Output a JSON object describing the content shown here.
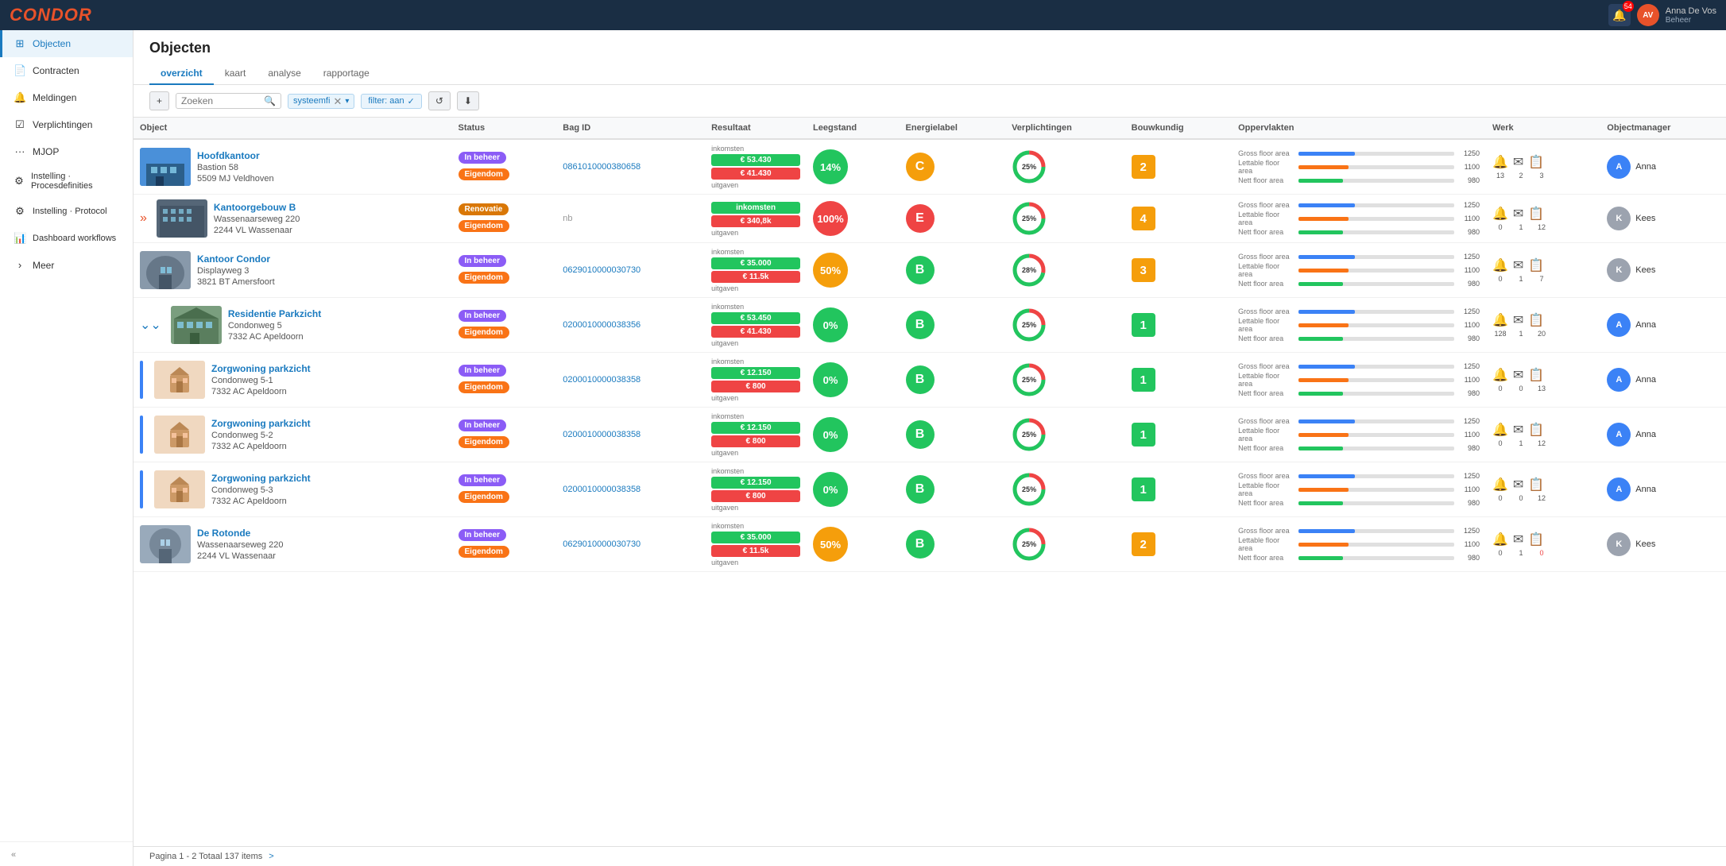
{
  "app": {
    "name": "CONDOR"
  },
  "topnav": {
    "notifications": "54",
    "user_name": "Anna De Vos",
    "user_role": "Beheer",
    "user_initials": "AV"
  },
  "sidebar": {
    "items": [
      {
        "id": "objecten",
        "label": "Objecten",
        "icon": "⊞",
        "active": true
      },
      {
        "id": "contracten",
        "label": "Contracten",
        "icon": "📄"
      },
      {
        "id": "meldingen",
        "label": "Meldingen",
        "icon": "🔔"
      },
      {
        "id": "verplichtingen",
        "label": "Verplichtingen",
        "icon": "☑"
      },
      {
        "id": "mjop",
        "label": "MJOP",
        "icon": "···"
      },
      {
        "id": "instelling-proc",
        "label": "Instelling · Procesdefinities",
        "icon": "⚙"
      },
      {
        "id": "instelling-prot",
        "label": "Instelling · Protocol",
        "icon": "⚙"
      },
      {
        "id": "dashboard",
        "label": "Dashboard workflows",
        "icon": "📊"
      },
      {
        "id": "meer",
        "label": "Meer",
        "icon": ">"
      }
    ],
    "collapse_label": "«"
  },
  "page": {
    "title": "Objecten",
    "tabs": [
      "overzicht",
      "kaart",
      "analyse",
      "rapportage"
    ],
    "active_tab": "overzicht"
  },
  "toolbar": {
    "add_label": "+",
    "search_placeholder": "Zoeken",
    "filter_tag": "systeemfi",
    "filter_active_label": "filter: aan",
    "check_icon": "✓",
    "refresh_icon": "↺",
    "download_icon": "⬇"
  },
  "table": {
    "columns": [
      "Object",
      "Status",
      "Bag ID",
      "Resultaat",
      "Leegstand",
      "Energielabel",
      "Verplichtingen",
      "Bouwkundig",
      "Oppervlakten",
      "Werk",
      "Objectmanager"
    ],
    "rows": [
      {
        "id": 1,
        "expand": null,
        "name": "Hoofdkantoor",
        "address1": "Bastion 58",
        "address2": "5509 MJ Veldhoven",
        "img_type": "building_blue",
        "status1": "In beheer",
        "status1_color": "purple",
        "status2": "Eigendom",
        "status2_color": "orange",
        "bag_id": "0861010000380658",
        "result_income": "€ 53.430",
        "result_income_color": "green",
        "result_expense": "€ 41.430",
        "result_expense_color": "red",
        "result_income_label": "inkomsten",
        "result_expense_label": "uitgaven",
        "leegstand": "14%",
        "leegstand_color": "green",
        "energy": "C",
        "energy_color": "c",
        "verpl_pct": 25,
        "bouw": "2",
        "bouw_color": "yellow",
        "opp_gross": 1250,
        "opp_lfa": 1100,
        "opp_nfa": 980,
        "werk_bell": 13,
        "werk_mail": 2,
        "werk_clip": 3,
        "werk_clip_red": false,
        "manager": "Anna",
        "manager_color": "#3b82f6",
        "indent": false,
        "indent_bar": false
      },
      {
        "id": 2,
        "expand": "double_right",
        "name": "Kantoorgebouw B",
        "address1": "Wassenaarseweg 220",
        "address2": "2244 VL Wassenaar",
        "img_type": "building_dark",
        "status1": "Renovatie",
        "status1_color": "yellow",
        "status2": "Eigendom",
        "status2_color": "orange",
        "bag_id": "nb",
        "result_income": "inkomsten",
        "result_income_color": "green",
        "result_expense": "€ 340,8k",
        "result_expense_color": "red",
        "result_income_label": "",
        "result_expense_label": "uitgaven",
        "leegstand": "100%",
        "leegstand_color": "red",
        "energy": "E",
        "energy_color": "e",
        "verpl_pct": 25,
        "bouw": "4",
        "bouw_color": "yellow",
        "opp_gross": 1250,
        "opp_lfa": 1100,
        "opp_nfa": 980,
        "werk_bell": 0,
        "werk_mail": 1,
        "werk_clip": 12,
        "werk_clip_red": false,
        "manager": "Kees",
        "manager_color": "#9ca3af",
        "indent": false,
        "indent_bar": false
      },
      {
        "id": 3,
        "expand": null,
        "name": "Kantoor Condor",
        "address1": "Displayweg 3",
        "address2": "3821 BT Amersfoort",
        "img_type": "building_round",
        "status1": "In beheer",
        "status1_color": "purple",
        "status2": "Eigendom",
        "status2_color": "orange",
        "bag_id": "0629010000030730",
        "result_income": "€ 35.000",
        "result_income_color": "green",
        "result_expense": "€ 11.5k",
        "result_expense_color": "red",
        "result_income_label": "inkomsten",
        "result_expense_label": "uitgaven",
        "leegstand": "50%",
        "leegstand_color": "yellow",
        "energy": "B",
        "energy_color": "b",
        "verpl_pct": 28,
        "bouw": "3",
        "bouw_color": "yellow",
        "opp_gross": 1250,
        "opp_lfa": 1100,
        "opp_nfa": 980,
        "werk_bell": 0,
        "werk_mail": 1,
        "werk_clip": 7,
        "werk_clip_red": false,
        "manager": "Kees",
        "manager_color": "#9ca3af",
        "indent": false,
        "indent_bar": false
      },
      {
        "id": 4,
        "expand": "double_down",
        "name": "Residentie Parkzicht",
        "address1": "Condonweg 5",
        "address2": "7332 AC Apeldoorn",
        "img_type": "building_green",
        "status1": "In beheer",
        "status1_color": "purple",
        "status2": "Eigendom",
        "status2_color": "orange",
        "bag_id": "0200010000038356",
        "result_income": "€ 53.450",
        "result_income_color": "green",
        "result_expense": "€ 41.430",
        "result_expense_color": "red",
        "result_income_label": "inkomsten",
        "result_expense_label": "uitgaven",
        "leegstand": "0%",
        "leegstand_color": "green",
        "energy": "B",
        "energy_color": "b",
        "verpl_pct": 25,
        "bouw": "1",
        "bouw_color": "green",
        "opp_gross": 1250,
        "opp_lfa": 1100,
        "opp_nfa": 980,
        "werk_bell": 128,
        "werk_mail": 1,
        "werk_clip": 20,
        "werk_clip_red": false,
        "manager": "Anna",
        "manager_color": "#3b82f6",
        "indent": false,
        "indent_bar": false
      },
      {
        "id": 5,
        "expand": null,
        "name": "Zorgwoning parkzicht",
        "address1": "Condonweg 5-1",
        "address2": "7332 AC Apeldoorn",
        "img_type": "care",
        "status1": "In beheer",
        "status1_color": "purple",
        "status2": "Eigendom",
        "status2_color": "orange",
        "bag_id": "0200010000038358",
        "result_income": "€ 12.150",
        "result_income_color": "green",
        "result_expense": "€ 800",
        "result_expense_color": "red",
        "result_income_label": "inkomsten",
        "result_expense_label": "uitgaven",
        "leegstand": "0%",
        "leegstand_color": "green",
        "energy": "B",
        "energy_color": "b",
        "verpl_pct": 25,
        "bouw": "1",
        "bouw_color": "green",
        "opp_gross": 1250,
        "opp_lfa": 1100,
        "opp_nfa": 980,
        "werk_bell": 0,
        "werk_mail": 0,
        "werk_clip": 13,
        "werk_clip_red": false,
        "manager": "Anna",
        "manager_color": "#3b82f6",
        "indent": true,
        "indent_bar": true
      },
      {
        "id": 6,
        "expand": null,
        "name": "Zorgwoning parkzicht",
        "address1": "Condonweg 5-2",
        "address2": "7332 AC Apeldoorn",
        "img_type": "care",
        "status1": "In beheer",
        "status1_color": "purple",
        "status2": "Eigendom",
        "status2_color": "orange",
        "bag_id": "0200010000038358",
        "result_income": "€ 12.150",
        "result_income_color": "green",
        "result_expense": "€ 800",
        "result_expense_color": "red",
        "result_income_label": "inkomsten",
        "result_expense_label": "uitgaven",
        "leegstand": "0%",
        "leegstand_color": "green",
        "energy": "B",
        "energy_color": "b",
        "verpl_pct": 25,
        "bouw": "1",
        "bouw_color": "green",
        "opp_gross": 1250,
        "opp_lfa": 1100,
        "opp_nfa": 980,
        "werk_bell": 0,
        "werk_mail": 1,
        "werk_clip": 12,
        "werk_clip_red": false,
        "manager": "Anna",
        "manager_color": "#3b82f6",
        "indent": true,
        "indent_bar": true
      },
      {
        "id": 7,
        "expand": null,
        "name": "Zorgwoning parkzicht",
        "address1": "Condonweg 5-3",
        "address2": "7332 AC Apeldoorn",
        "img_type": "care",
        "status1": "In beheer",
        "status1_color": "purple",
        "status2": "Eigendom",
        "status2_color": "orange",
        "bag_id": "0200010000038358",
        "result_income": "€ 12.150",
        "result_income_color": "green",
        "result_expense": "€ 800",
        "result_expense_color": "red",
        "result_income_label": "inkomsten",
        "result_expense_label": "uitgaven",
        "leegstand": "0%",
        "leegstand_color": "green",
        "energy": "B",
        "energy_color": "b",
        "verpl_pct": 25,
        "bouw": "1",
        "bouw_color": "green",
        "opp_gross": 1250,
        "opp_lfa": 1100,
        "opp_nfa": 980,
        "werk_bell": 0,
        "werk_mail": 0,
        "werk_clip": 12,
        "werk_clip_red": false,
        "manager": "Anna",
        "manager_color": "#3b82f6",
        "indent": true,
        "indent_bar": true
      },
      {
        "id": 8,
        "expand": null,
        "name": "De Rotonde",
        "address1": "Wassenaarseweg 220",
        "address2": "2244 VL Wassenaar",
        "img_type": "building_round2",
        "status1": "In beheer",
        "status1_color": "purple",
        "status2": "Eigendom",
        "status2_color": "orange",
        "bag_id": "0629010000030730",
        "result_income": "€ 35.000",
        "result_income_color": "green",
        "result_expense": "€ 11.5k",
        "result_expense_color": "red",
        "result_income_label": "inkomsten",
        "result_expense_label": "uitgaven",
        "leegstand": "50%",
        "leegstand_color": "yellow",
        "energy": "B",
        "energy_color": "b",
        "verpl_pct": 25,
        "bouw": "2",
        "bouw_color": "yellow",
        "opp_gross": 1250,
        "opp_lfa": 1100,
        "opp_nfa": 980,
        "werk_bell": 0,
        "werk_mail": 1,
        "werk_clip": 0,
        "werk_clip_red": true,
        "manager": "Kees",
        "manager_color": "#9ca3af",
        "indent": false,
        "indent_bar": false
      }
    ]
  },
  "pagination": {
    "label": "Pagina 1 - 2 Totaal 137 items",
    "next_label": ">"
  }
}
